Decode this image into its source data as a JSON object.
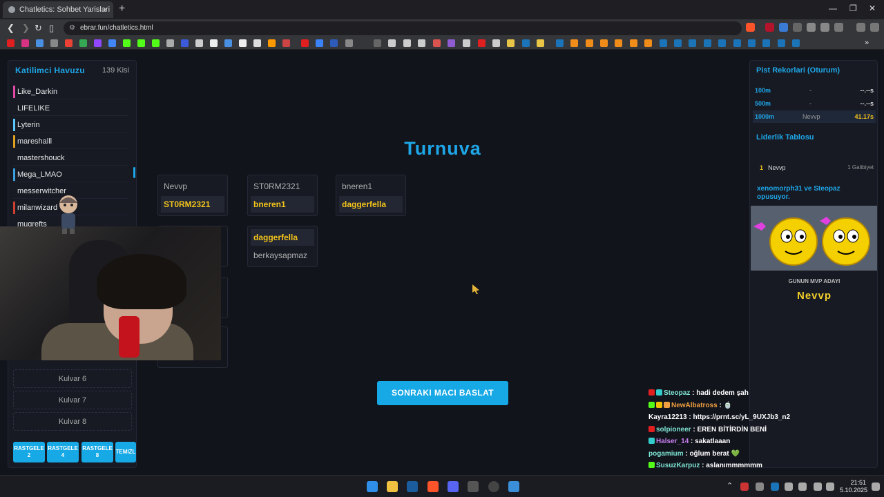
{
  "browser": {
    "tab_title": "Chatletics: Sohbet Yarislari",
    "url": "ebrar.fun/chatletics.html",
    "close_glyph": "×",
    "new_tab_glyph": "+"
  },
  "left_panel": {
    "title": "Katilimci Havuzu",
    "count": "139 Kisi",
    "participants": [
      {
        "name": "Like_Darkin",
        "color": "#e34aa6"
      },
      {
        "name": "LIFELIKE",
        "color": ""
      },
      {
        "name": "Lyterin",
        "color": "#5ac8fa"
      },
      {
        "name": "mareshalll",
        "color": "#e0a020"
      },
      {
        "name": "mastershouck",
        "color": ""
      },
      {
        "name": "Mega_LMAO",
        "color": "#3aa0e0"
      },
      {
        "name": "messerwitcher",
        "color": ""
      },
      {
        "name": "milanwizard",
        "color": "#d04030"
      },
      {
        "name": "mugrefts",
        "color": ""
      }
    ],
    "lanes": [
      "Kulvar 6",
      "Kulvar 7",
      "Kulvar 8"
    ],
    "buttons": [
      "RASTGELE 2",
      "RASTGELE 4",
      "RASTGELE 8",
      "TEMIZL"
    ]
  },
  "center": {
    "title": "Turnuva",
    "matches": [
      {
        "p1": "Nevvp",
        "p2": "ST0RM2321",
        "winner": 2
      },
      {
        "p1": "ST0RM2321",
        "p2": "bneren1",
        "winner": 2
      },
      {
        "p1": "bneren1",
        "p2": "daggerfella",
        "winner": 2
      },
      {
        "p1": "daggerfella",
        "p2": "berkaysapmaz",
        "winner": 1
      }
    ],
    "start_button": "SONRAKI MACI BASLAT"
  },
  "right_panel": {
    "records_title": "Pist Rekorlari (Oturum)",
    "records": [
      {
        "distance": "100m",
        "name": "-",
        "time": "--.--s"
      },
      {
        "distance": "500m",
        "name": "-",
        "time": "--.--s"
      },
      {
        "distance": "1000m",
        "name": "Nevvp",
        "time": "41.17s"
      }
    ],
    "leaderboard_title": "Liderlik Tablosu",
    "leaderboard": [
      {
        "rank": "1",
        "name": "Nevvp",
        "wins": "1 Galibiyet"
      }
    ],
    "kiss_text": "xenomorph31 ve Steopaz opusuyor.",
    "mvp_label": "GUNUN MVP ADAYI",
    "mvp_name": "Nevvp"
  },
  "chat": [
    {
      "user": "Steopaz",
      "msg": ": hadi dedem şah",
      "color": "#7ee6d4"
    },
    {
      "user": "NewAlbatross",
      "msg": ": 🍵",
      "color": "#f0a040"
    },
    {
      "user": "Kayra12213",
      "msg": ": https://prnt.sc/yL_9UXJb3_n2",
      "color": "#ffffff"
    },
    {
      "user": "solpioneer",
      "msg": ": EREN BİTİRDİN BENİ",
      "color": "#7ee6d4"
    },
    {
      "user": "Halser_14",
      "msg": ": sakatlaaan",
      "color": "#c77ef0"
    },
    {
      "user": "pogamium",
      "msg": ": oğlum berat 💚",
      "color": "#7ee6d4"
    },
    {
      "user": "SusuzKarpuz",
      "msg": ": aslanımmmmmm",
      "color": "#7ee6d4"
    }
  ],
  "taskbar": {
    "time": "21:51",
    "date": "5.10.2025"
  }
}
